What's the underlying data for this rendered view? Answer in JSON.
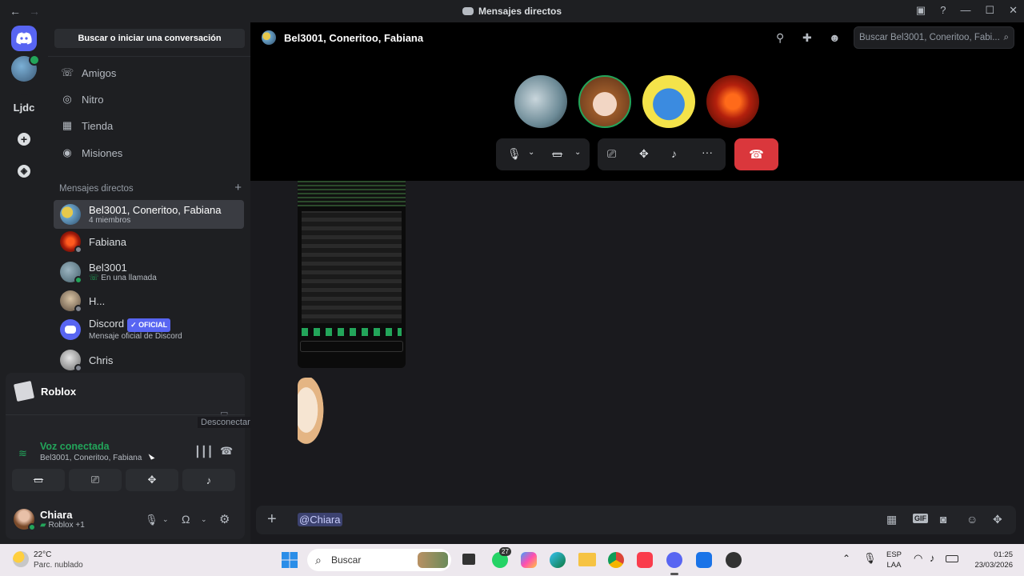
{
  "titlebar": {
    "title": "Mensajes directos"
  },
  "sidebar": {
    "search_label": "Buscar o iniciar una conversación",
    "nav": [
      {
        "label": "Amigos"
      },
      {
        "label": "Nitro"
      },
      {
        "label": "Tienda"
      },
      {
        "label": "Misiones"
      }
    ],
    "dm_header": "Mensajes directos",
    "dms": [
      {
        "name": "Bel3001, Coneritoo, Fabiana",
        "sub": "4 miembros"
      },
      {
        "name": "Fabiana",
        "sub": ""
      },
      {
        "name": "Bel3001",
        "sub": "En una llamada"
      },
      {
        "name": "H...",
        "sub": ""
      },
      {
        "name": "Discord",
        "badge": "✓ OFICIAL",
        "sub": "Mensaje oficial de Discord"
      },
      {
        "name": "Chris",
        "sub": ""
      }
    ]
  },
  "guilds": {
    "server_label": "Ljdc"
  },
  "activity": {
    "game": "Roblox",
    "tooltip": "Desconectar"
  },
  "voice": {
    "status": "Voz conectada",
    "channel": "Bel3001, Coneritoo, Fabiana"
  },
  "user": {
    "name": "Chiara",
    "status": "Roblox +1"
  },
  "header": {
    "channel": "Bel3001, Coneritoo, Fabiana",
    "search_placeholder": "Buscar Bel3001, Coneritoo, Fabi..."
  },
  "composer": {
    "mention": "@Chiara"
  },
  "taskbar": {
    "weather_temp": "22°C",
    "weather_desc": "Parc. nublado",
    "search": "Buscar",
    "whatsapp_badge": "27",
    "lang1": "ESP",
    "lang2": "LAA",
    "time": "01:25",
    "date": "23/03/2026"
  },
  "colors": {
    "accent": "#5865f2",
    "danger": "#da373c",
    "online": "#23a55a"
  }
}
